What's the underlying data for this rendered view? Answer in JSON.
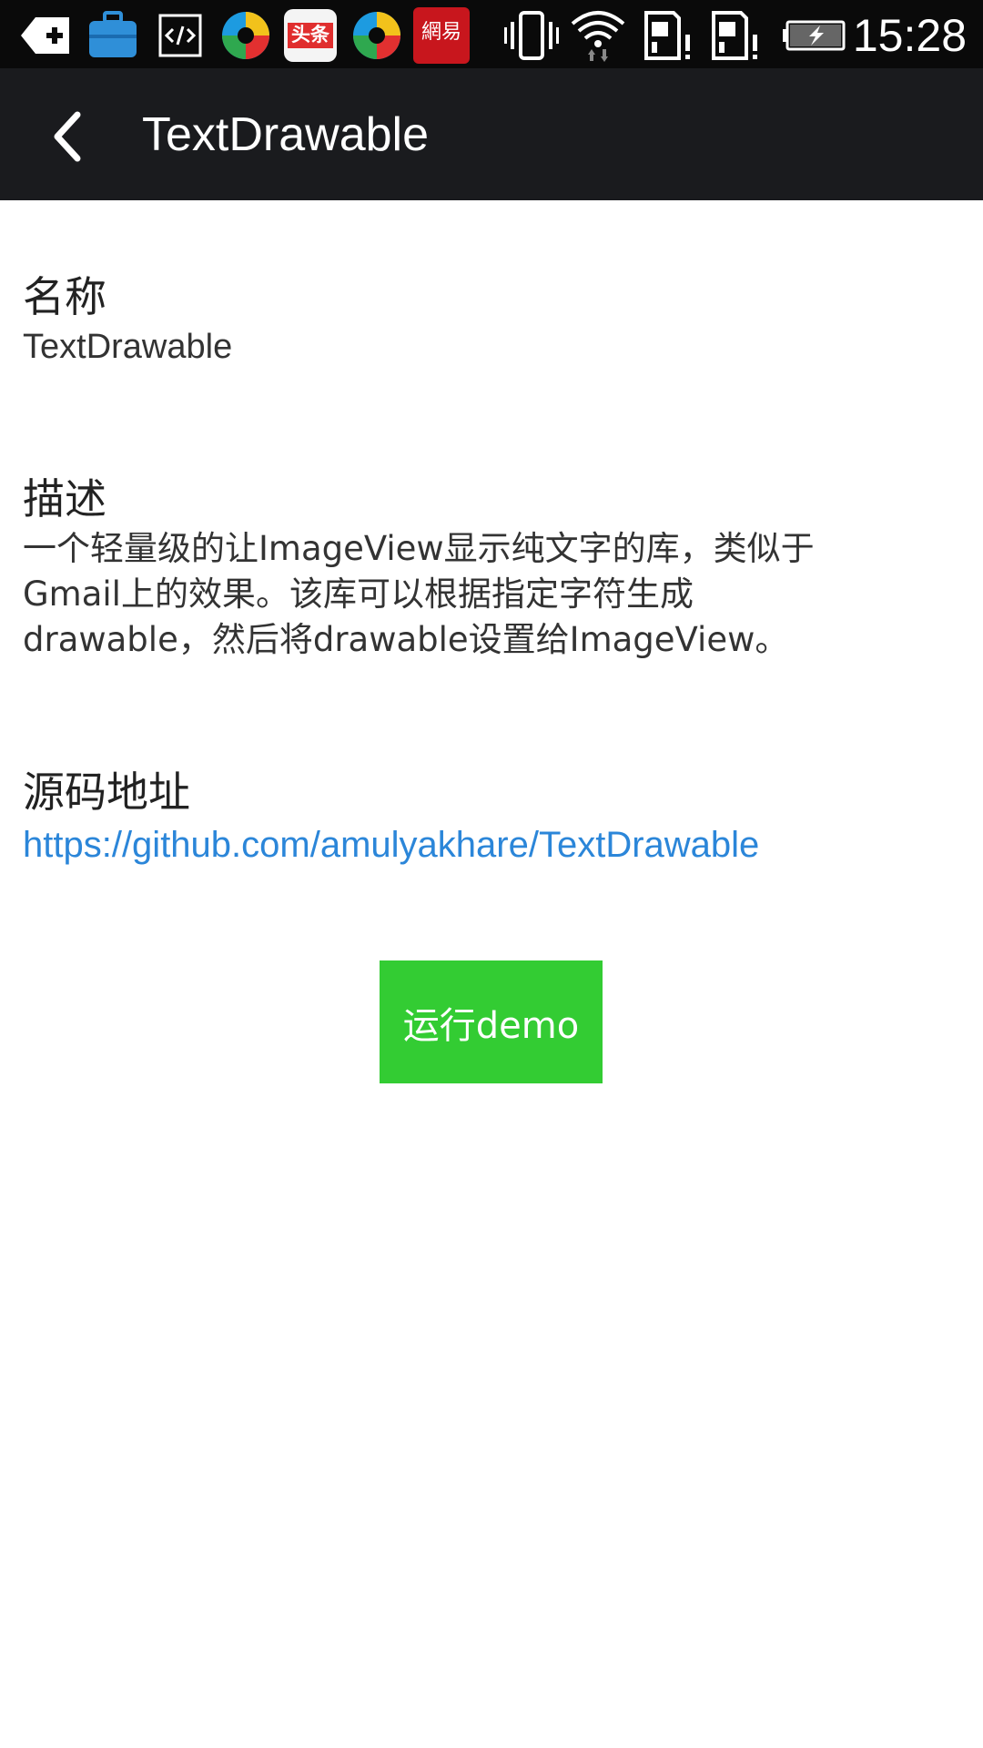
{
  "status_bar": {
    "time": "15:28",
    "icons": [
      "back-plus-icon",
      "toolbox-icon",
      "code-icon",
      "browser-icon",
      "toutiao-app-icon",
      "browser-icon",
      "netease-app-icon",
      "vibrate-icon",
      "wifi-icon",
      "sim-alert-icon",
      "sim-alert-icon",
      "battery-charging-icon"
    ],
    "toutiao_label": "头条",
    "netease_label": "網易"
  },
  "app_bar": {
    "title": "TextDrawable",
    "back_icon": "chevron-left-icon"
  },
  "sections": {
    "name": {
      "heading": "名称",
      "value": "TextDrawable"
    },
    "description": {
      "heading": "描述",
      "value": "一个轻量级的让ImageView显示纯文字的库，类似于Gmail上的效果。该库可以根据指定字符生成drawable，然后将drawable设置给ImageView。"
    },
    "source": {
      "heading": "源码地址",
      "url": "https://github.com/amulyakhare/TextDrawable"
    }
  },
  "run_button": {
    "label": "运行demo"
  },
  "colors": {
    "status_bar_bg": "#0a0a0a",
    "app_bar_bg": "#1a1b1e",
    "link": "#2b86d9",
    "button_bg": "#33cc33"
  }
}
